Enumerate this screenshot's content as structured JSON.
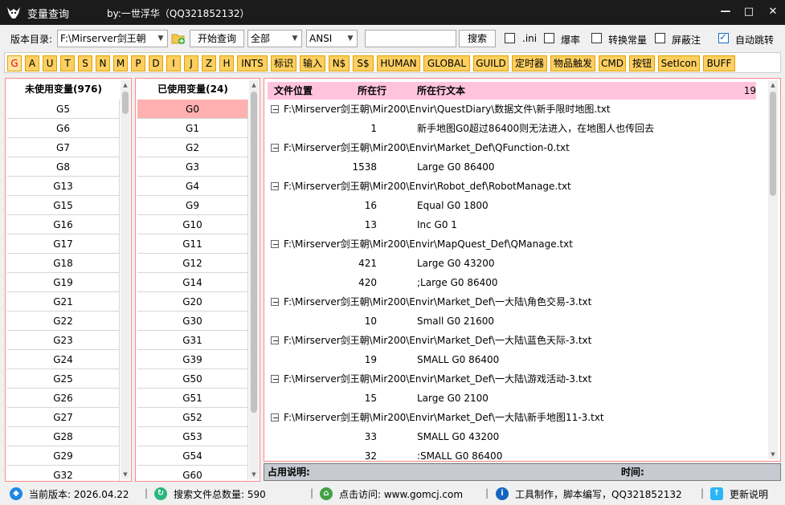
{
  "titlebar": {
    "title": "变量查询",
    "author": "by:一世浮华（QQ321852132）",
    "min": "—",
    "max": "□",
    "close": "✕"
  },
  "toolbar": {
    "dir_label": "版本目录:",
    "dir_value": "F:\\Mirserver剑王朝",
    "start_button": "开始查询",
    "scope_value": "全部",
    "encoding_value": "ANSI",
    "search_value": "",
    "search_button": "搜索",
    "checks": [
      {
        "label": ".ini",
        "checked": false
      },
      {
        "label": "爆率",
        "checked": false
      },
      {
        "label": "转换常量",
        "checked": false
      },
      {
        "label": "屏蔽注",
        "checked": false
      },
      {
        "label": "自动跳转",
        "checked": true
      }
    ]
  },
  "letters": [
    "G",
    "A",
    "U",
    "T",
    "S",
    "N",
    "M",
    "P",
    "D",
    "I",
    "J",
    "Z",
    "H",
    "INTS",
    "标识",
    "输入",
    "N$",
    "S$",
    "HUMAN",
    "GLOBAL",
    "GUILD",
    "定时器",
    "物品触发",
    "CMD",
    "按钮",
    "SetIcon",
    "BUFF"
  ],
  "unused": {
    "header": "未使用变量(976)",
    "items": [
      "G5",
      "G6",
      "G7",
      "G8",
      "G13",
      "G15",
      "G16",
      "G17",
      "G18",
      "G19",
      "G21",
      "G22",
      "G23",
      "G24",
      "G25",
      "G26",
      "G27",
      "G28",
      "G29",
      "G32"
    ]
  },
  "used": {
    "header": "已使用变量(24)",
    "items": [
      "G0",
      "G1",
      "G2",
      "G3",
      "G4",
      "G9",
      "G10",
      "G11",
      "G12",
      "G14",
      "G20",
      "G30",
      "G31",
      "G39",
      "G50",
      "G51",
      "G52",
      "G53",
      "G54",
      "G60"
    ]
  },
  "results": {
    "col_file": "文件位置",
    "col_line": "所在行",
    "col_text": "所在行文本",
    "count": "19",
    "rows": [
      {
        "kind": "file",
        "text": "F:\\Mirserver剑王朝\\Mir200\\Envir\\QuestDiary\\数据文件\\新手限时地图.txt"
      },
      {
        "kind": "line",
        "line": "1",
        "text": "新手地图G0超过86400则无法进入，在地图人也传回去"
      },
      {
        "kind": "file",
        "text": "F:\\Mirserver剑王朝\\Mir200\\Envir\\Market_Def\\QFunction-0.txt"
      },
      {
        "kind": "line",
        "line": "1538",
        "text": "Large G0 86400"
      },
      {
        "kind": "file",
        "text": "F:\\Mirserver剑王朝\\Mir200\\Envir\\Robot_def\\RobotManage.txt"
      },
      {
        "kind": "line",
        "line": "16",
        "text": "Equal G0 1800"
      },
      {
        "kind": "line",
        "line": "13",
        "text": "Inc G0 1"
      },
      {
        "kind": "file",
        "text": "F:\\Mirserver剑王朝\\Mir200\\Envir\\MapQuest_Def\\QManage.txt"
      },
      {
        "kind": "line",
        "line": "421",
        "text": "Large G0 43200"
      },
      {
        "kind": "line",
        "line": "420",
        "text": ";Large G0 86400"
      },
      {
        "kind": "file",
        "text": "F:\\Mirserver剑王朝\\Mir200\\Envir\\Market_Def\\一大陆\\角色交易-3.txt"
      },
      {
        "kind": "line",
        "line": "10",
        "text": "Small G0 21600"
      },
      {
        "kind": "file",
        "text": "F:\\Mirserver剑王朝\\Mir200\\Envir\\Market_Def\\一大陆\\蓝色天际-3.txt"
      },
      {
        "kind": "line",
        "line": "19",
        "text": "SMALL G0 86400"
      },
      {
        "kind": "file",
        "text": "F:\\Mirserver剑王朝\\Mir200\\Envir\\Market_Def\\一大陆\\游戏活动-3.txt"
      },
      {
        "kind": "line",
        "line": "15",
        "text": "Large G0 2100"
      },
      {
        "kind": "file",
        "text": "F:\\Mirserver剑王朝\\Mir200\\Envir\\Market_Def\\一大陆\\新手地图11-3.txt"
      },
      {
        "kind": "line",
        "line": "33",
        "text": "SMALL G0 43200"
      },
      {
        "kind": "line",
        "line": "32",
        "text": ":SMALL G0 86400"
      }
    ]
  },
  "infobar": {
    "usage_label": "占用说明:",
    "time_label": "时间:"
  },
  "status": {
    "version": "当前版本: 2026.04.22",
    "files": "搜索文件总数量: 590",
    "visit": "点击访问: www.gomcj.com",
    "credit": "工具制作，脚本编写，QQ321852132",
    "update": "更新说明",
    "sep": "|"
  },
  "colors": {
    "accent_yellow": "#fccf60",
    "selected_row": "#ffb0b0",
    "header_pink": "#ffc4dc",
    "titlebar": "#1b1b1b"
  }
}
